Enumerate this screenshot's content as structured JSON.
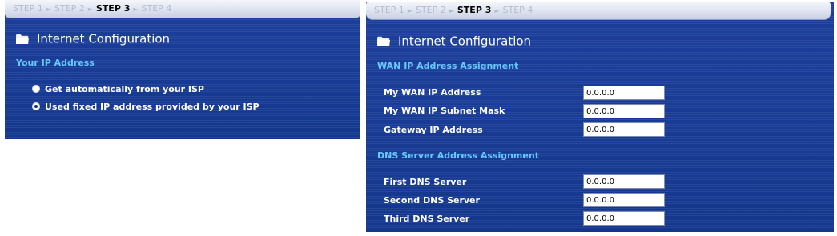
{
  "steps": [
    "STEP 1",
    "STEP 2",
    "STEP 3",
    "STEP 4"
  ],
  "active_step": "STEP 3",
  "title": "Internet Configuration",
  "left_panel": {
    "section": "Your IP Address",
    "options": [
      {
        "label": "Get automatically from your ISP",
        "checked": false
      },
      {
        "label": "Used fixed IP address provided by your ISP",
        "checked": true
      }
    ]
  },
  "right_panel": {
    "wan_section": "WAN IP Address Assignment",
    "wan_fields": [
      {
        "label": "My WAN IP Address",
        "value": "0.0.0.0"
      },
      {
        "label": "My WAN IP Subnet Mask",
        "value": "0.0.0.0"
      },
      {
        "label": "Gateway IP Address",
        "value": "0.0.0.0"
      }
    ],
    "dns_section": "DNS Server Address Assignment",
    "dns_fields": [
      {
        "label": "First DNS Server",
        "value": "0.0.0.0"
      },
      {
        "label": "Second DNS Server",
        "value": "0.0.0.0"
      },
      {
        "label": "Third DNS Server",
        "value": "0.0.0.0"
      }
    ]
  },
  "icons": {
    "folder": "folder-icon",
    "step_separator": "triangle-right-icon",
    "radio": "radio-button-icon"
  },
  "colors": {
    "panel_bg": "#1a3d98",
    "section_heading": "#66c9ff",
    "step_inactive": "#b3bbcf",
    "step_active": "#000000"
  }
}
